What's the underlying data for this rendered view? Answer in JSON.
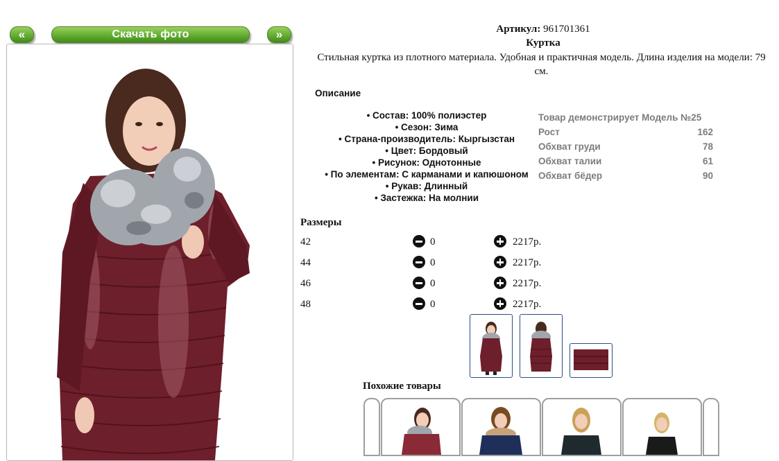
{
  "gallery": {
    "prev_label": "«",
    "download_label": "Скачать фото",
    "next_label": "»"
  },
  "product": {
    "article_label": "Артикул:",
    "article_value": "961701361",
    "name": "Куртка",
    "description_line1": "Стильная куртка из плотного материала. Удобная и практичная модель. Длина изделия на модели: 79",
    "description_line2": "см.",
    "description_heading": "Описание",
    "attributes": [
      "• Состав: 100% полиэстер",
      "• Сезон: Зима",
      "• Страна-производитель: Кыргызстан",
      "• Цвет: Бордовый",
      "• Рисунок: Однотонные",
      "• По элементам: С карманами и капюшоном",
      "• Рукав: Длинный",
      "• Застежка: На молнии"
    ]
  },
  "model": {
    "heading": "Товар демонстрирует Модель №25",
    "rows": [
      {
        "label": "Рост",
        "value": "162"
      },
      {
        "label": "Обхват груди",
        "value": "78"
      },
      {
        "label": "Обхват талии",
        "value": "61"
      },
      {
        "label": "Обхват бёдер",
        "value": "90"
      }
    ]
  },
  "sizes": {
    "heading": "Размеры",
    "rows": [
      {
        "size": "42",
        "qty": "0",
        "price": "2217р."
      },
      {
        "size": "44",
        "qty": "0",
        "price": "2217р."
      },
      {
        "size": "46",
        "qty": "0",
        "price": "2217р."
      },
      {
        "size": "48",
        "qty": "0",
        "price": "2217р."
      }
    ]
  },
  "similar": {
    "heading": "Похожие товары"
  },
  "colors": {
    "button_green": "#6db33a",
    "jacket": "#6e1f2c",
    "fur": "#9aa0a8",
    "thumb_border": "#2b4c86"
  }
}
